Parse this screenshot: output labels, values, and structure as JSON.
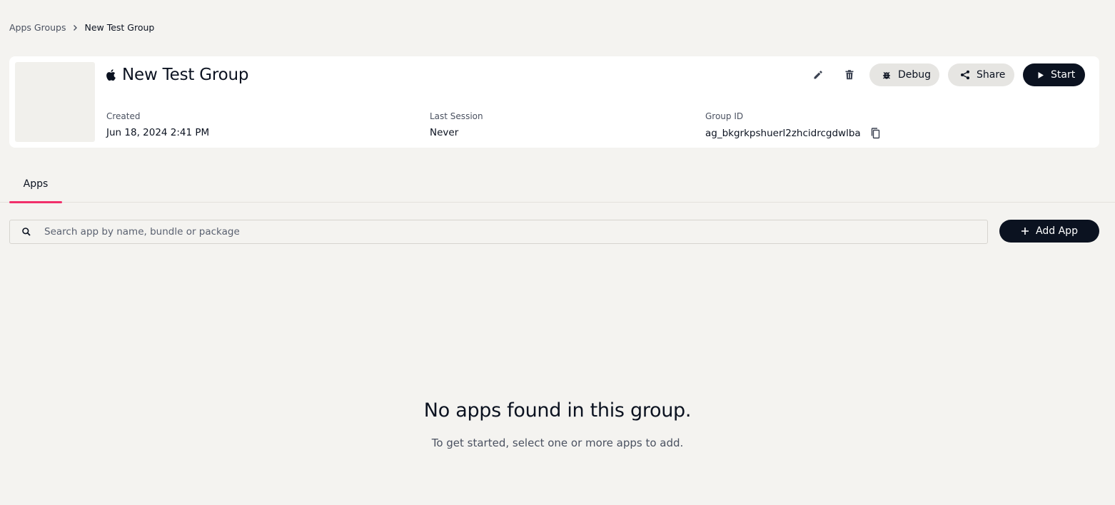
{
  "breadcrumb": {
    "parent": "Apps Groups",
    "current": "New Test Group"
  },
  "group": {
    "platform_icon": "apple-icon",
    "title": "New Test Group",
    "created_label": "Created",
    "created_value": "Jun 18, 2024 2:41 PM",
    "last_session_label": "Last Session",
    "last_session_value": "Never",
    "group_id_label": "Group ID",
    "group_id_value": "ag_bkgrkpshuerl2zhcidrcgdwlba"
  },
  "actions": {
    "edit_icon": "pencil-icon",
    "delete_icon": "trash-icon",
    "debug_label": "Debug",
    "share_label": "Share",
    "start_label": "Start"
  },
  "tabs": [
    {
      "label": "Apps",
      "active": true
    }
  ],
  "search": {
    "placeholder": "Search app by name, bundle or package",
    "value": ""
  },
  "add_app_label": "Add App",
  "empty_state": {
    "title": "No apps found in this group.",
    "subtitle": "To get started, select one or more apps to add."
  },
  "colors": {
    "background": "#f4f3f0",
    "primary_dark": "#0b1220",
    "tab_accent": "#f0306b",
    "pill_light": "#e6e5e2"
  }
}
